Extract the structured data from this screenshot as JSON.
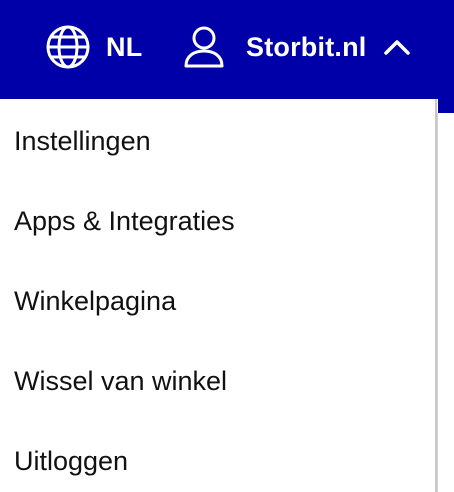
{
  "header": {
    "language": {
      "label": "NL",
      "icon": "globe-icon"
    },
    "account": {
      "label": "Storbit.nl",
      "icon": "user-icon",
      "toggle_icon": "chevron-up-icon"
    }
  },
  "menu": {
    "items": [
      {
        "label": "Instellingen"
      },
      {
        "label": "Apps & Integraties"
      },
      {
        "label": "Winkelpagina"
      },
      {
        "label": "Wissel van winkel"
      },
      {
        "label": "Uitloggen"
      }
    ]
  },
  "colors": {
    "header_background": "#0000a8",
    "header_text": "#ffffff",
    "menu_text": "#111111",
    "menu_background": "#ffffff"
  }
}
